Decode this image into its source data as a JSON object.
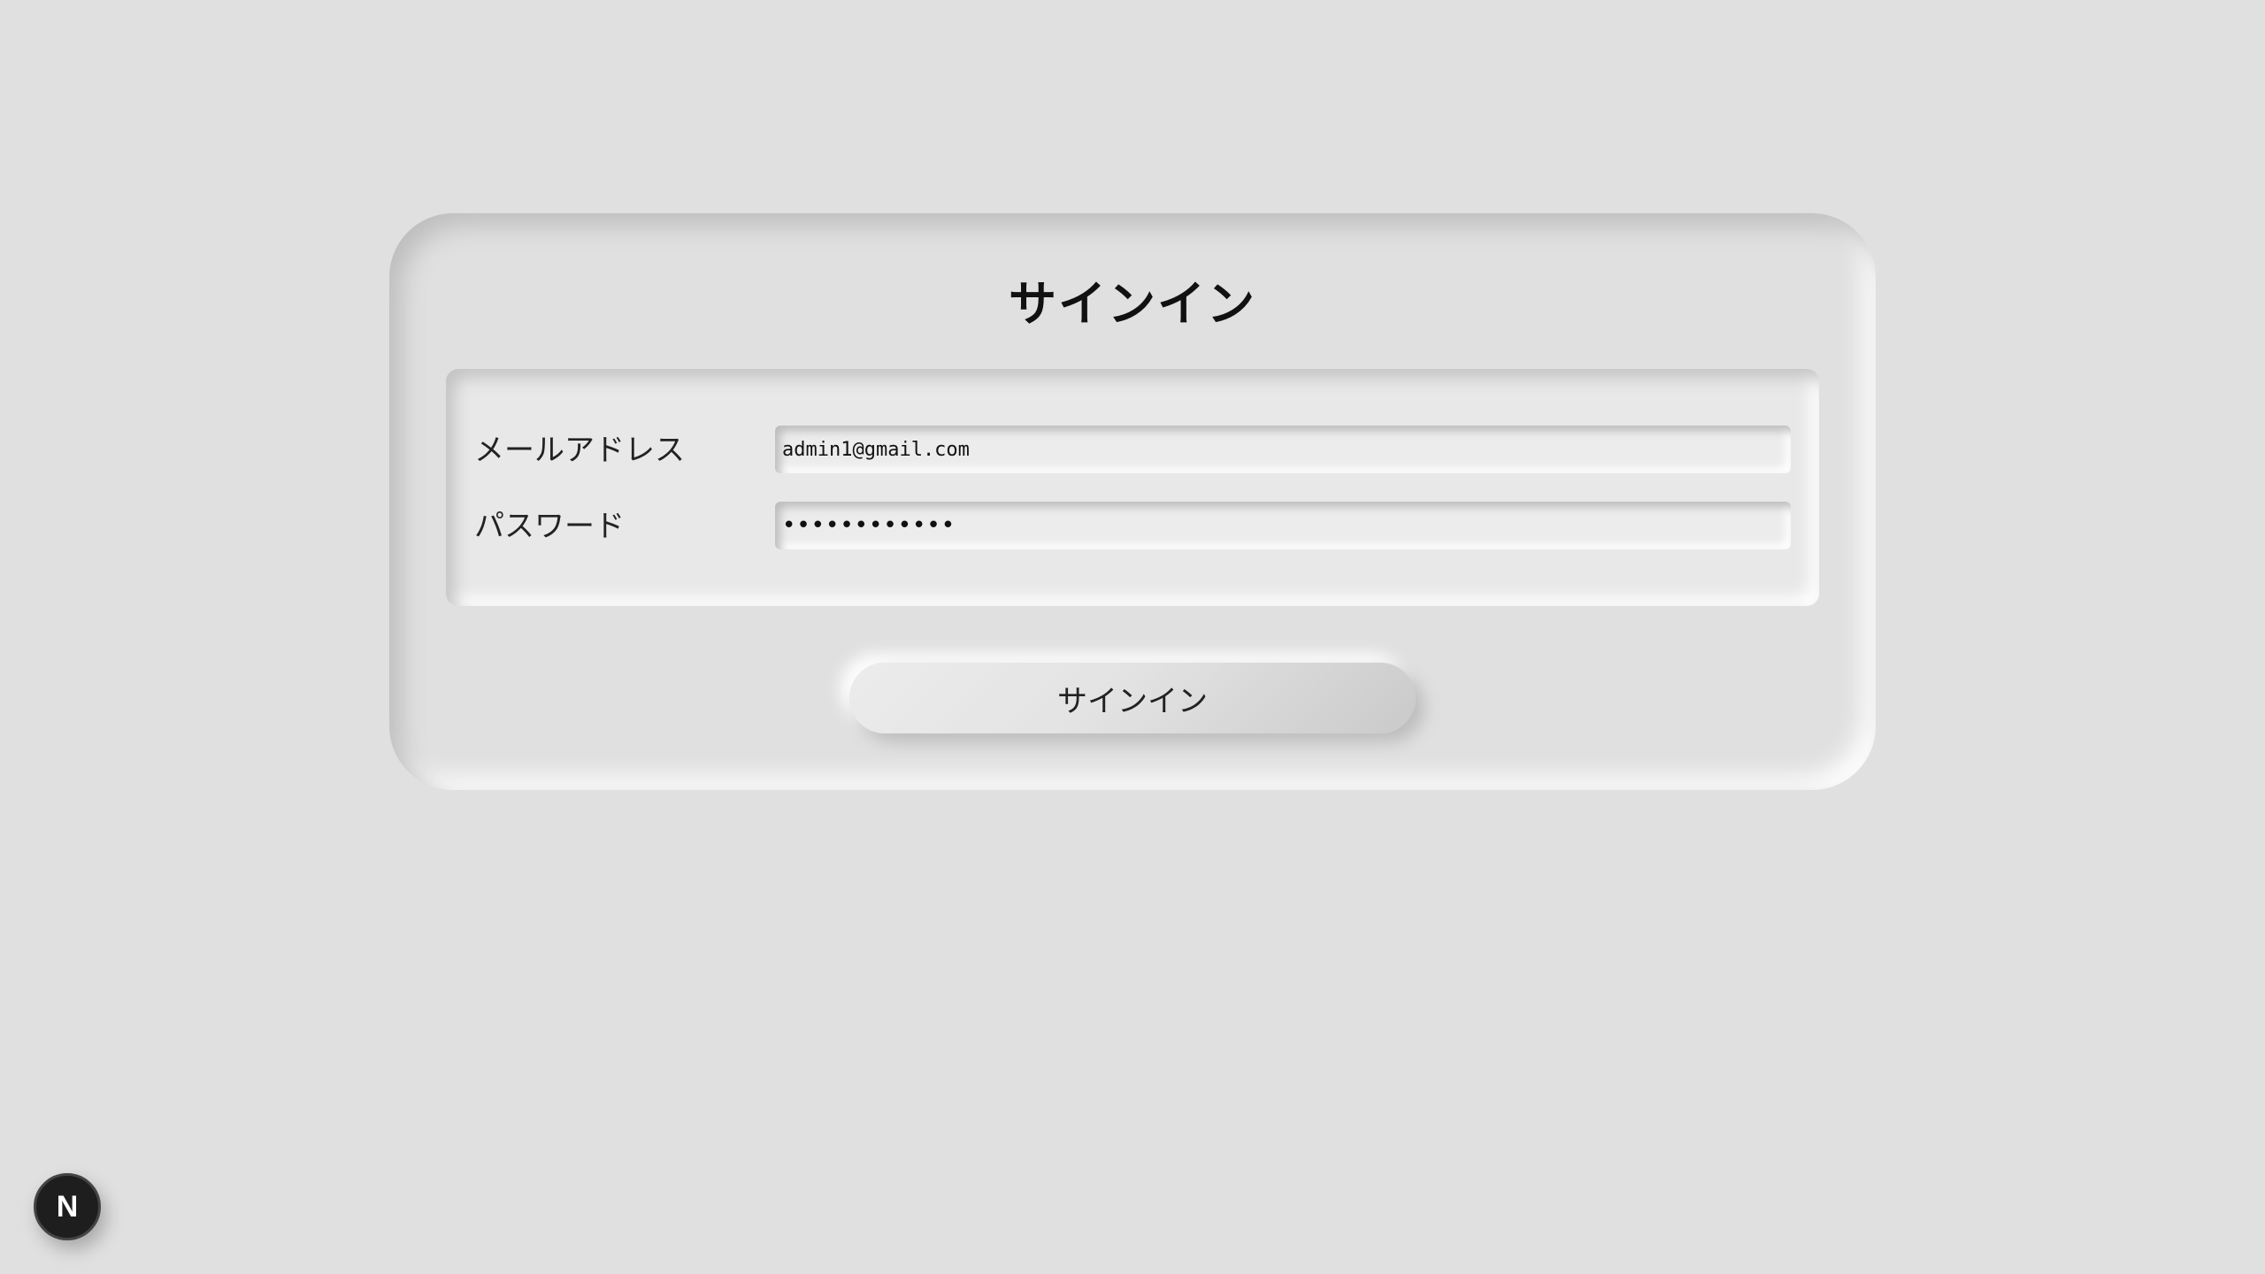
{
  "signin_form": {
    "title": "サインイン",
    "email": {
      "label": "メールアドレス",
      "value": "admin1@gmail.com"
    },
    "password": {
      "label": "パスワード",
      "value": "••••••••••••"
    },
    "submit_label": "サインイン"
  },
  "dev_badge": {
    "icon": "nextjs-logo-icon",
    "letter": "N",
    "color": "#1e1e1e"
  },
  "colors": {
    "background": "#e0e0e0",
    "text": "#111111"
  }
}
